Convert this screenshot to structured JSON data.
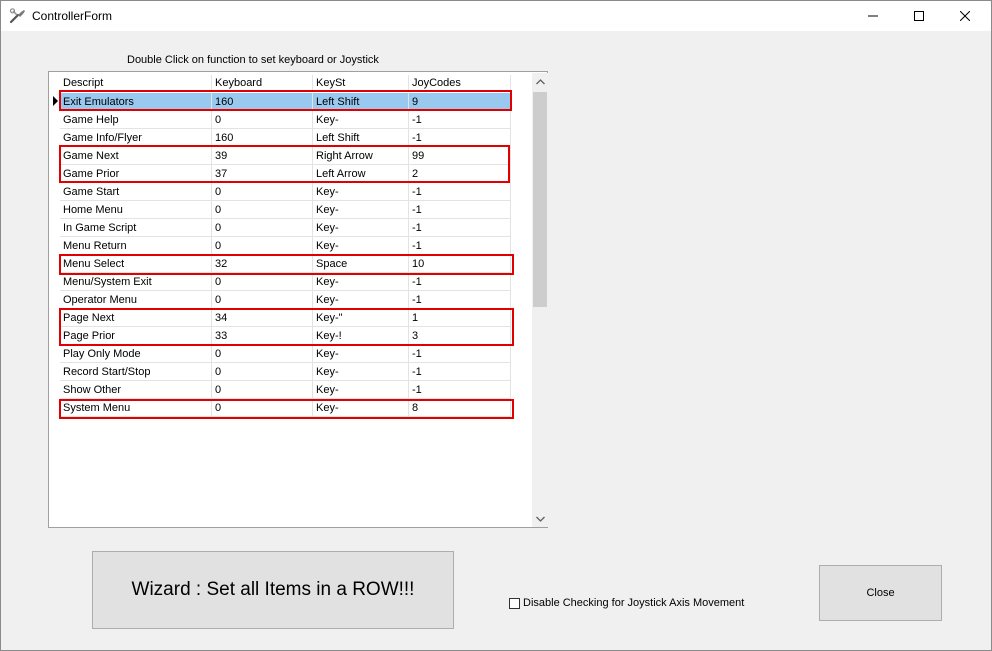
{
  "window": {
    "title": "ControllerForm",
    "icon": "tools-icon",
    "controls": [
      "minimize-icon",
      "maximize-icon",
      "close-icon"
    ]
  },
  "hint": "Double Click on function to set keyboard or Joystick",
  "grid": {
    "headers": [
      "Descript",
      "Keyboard",
      "KeySt",
      "JoyCodes"
    ],
    "selected_index": 0,
    "rows": [
      [
        "Exit Emulators",
        "160",
        "Left Shift",
        "9"
      ],
      [
        "Game Help",
        "0",
        "Key-",
        "-1"
      ],
      [
        "Game Info/Flyer",
        "160",
        "Left Shift",
        "-1"
      ],
      [
        "Game Next",
        "39",
        "Right Arrow",
        "99"
      ],
      [
        "Game Prior",
        "37",
        "Left Arrow",
        "2"
      ],
      [
        "Game Start",
        "0",
        "Key-",
        "-1"
      ],
      [
        "Home Menu",
        "0",
        "Key-",
        "-1"
      ],
      [
        "In Game Script",
        "0",
        "Key-",
        "-1"
      ],
      [
        "Menu Return",
        "0",
        "Key-",
        "-1"
      ],
      [
        "Menu Select",
        "32",
        "Space",
        "10"
      ],
      [
        "Menu/System Exit",
        "0",
        "Key-",
        "-1"
      ],
      [
        "Operator Menu",
        "0",
        "Key-",
        "-1"
      ],
      [
        "Page Next",
        "34",
        "Key-\"",
        "1"
      ],
      [
        "Page Prior",
        "33",
        "Key-!",
        "3"
      ],
      [
        "Play Only Mode",
        "0",
        "Key-",
        "-1"
      ],
      [
        "Record Start/Stop",
        "0",
        "Key-",
        "-1"
      ],
      [
        "Show Other",
        "0",
        "Key-",
        "-1"
      ],
      [
        "System Menu",
        "0",
        "Key-",
        "8"
      ]
    ],
    "highlight_color": "#e00000",
    "selection_color": "#99c9ef"
  },
  "wizard_button": "Wizard :  Set all Items in a ROW!!!",
  "joystick_checkbox": {
    "label": "Disable Checking for Joystick Axis Movement",
    "checked": false
  },
  "close_button": "Close"
}
